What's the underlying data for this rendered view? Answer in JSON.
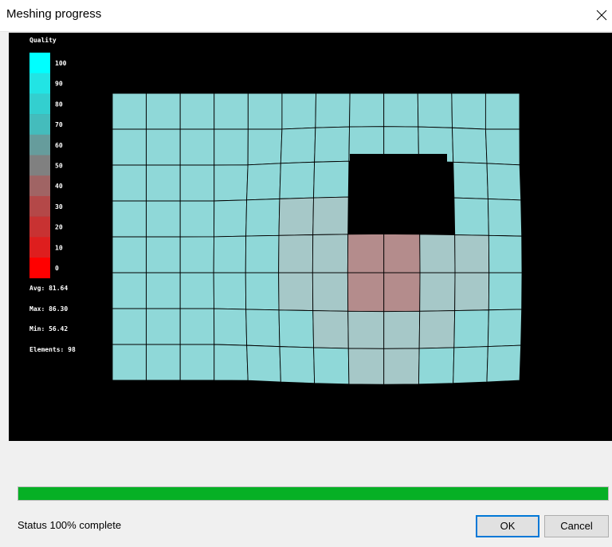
{
  "window": {
    "title": "Meshing progress",
    "close_icon": "close-icon"
  },
  "legend": {
    "title": "Quality",
    "labels": [
      "100",
      "90",
      "80",
      "70",
      "60",
      "50",
      "40",
      "30",
      "20",
      "10",
      "0"
    ],
    "colors": [
      "#00ffff",
      "#22e4e4",
      "#33cfcf",
      "#44bcbc",
      "#669c9c",
      "#808080",
      "#a06464",
      "#b44848",
      "#c83232",
      "#de1e1e",
      "#ff0000"
    ]
  },
  "stats": {
    "avg": "Avg: 81.64",
    "max": "Max: 86.30",
    "min": "Min: 56.42",
    "elements": "Elements: 98"
  },
  "mesh": {
    "background_color": "#000000",
    "element_color_high": "#8fd8d8",
    "element_color_mid": "#a6c8c8",
    "element_color_low": "#b48c8c"
  },
  "progress": {
    "value_percent": 100,
    "color": "#06b025"
  },
  "status": {
    "text": "Status 100% complete"
  },
  "buttons": {
    "ok": "OK",
    "cancel": "Cancel"
  }
}
